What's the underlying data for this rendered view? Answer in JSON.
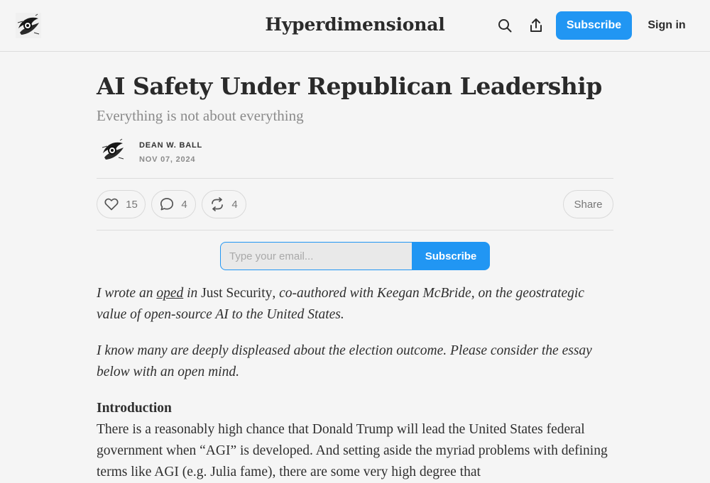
{
  "header": {
    "site_title": "Hyperdimensional",
    "subscribe_label": "Subscribe",
    "signin_label": "Sign in",
    "logo_icon": "publication-logo",
    "search_icon": "search-icon",
    "share_icon": "share-icon"
  },
  "post": {
    "title": "AI Safety Under Republican Leadership",
    "subtitle": "Everything is not about everything",
    "author": "DEAN W. BALL",
    "date": "NOV 07, 2024"
  },
  "actions": {
    "likes": "15",
    "comments": "4",
    "restacks": "4",
    "share_label": "Share"
  },
  "subscribe_form": {
    "placeholder": "Type your email...",
    "button_label": "Subscribe"
  },
  "content": {
    "p1_prefix": "I wrote an ",
    "p1_link": "oped",
    "p1_middle": " in ",
    "p1_roman": "Just Security",
    "p1_suffix": ", co-authored with Keegan McBride, on the geostrategic value of open-source AI to the United States.",
    "p2": "I know many are deeply displeased about the election outcome. Please consider the essay below with an open mind.",
    "heading": "Introduction",
    "p3": "There is a reasonably high chance that Donald Trump will lead the United States federal government when “AGI” is developed. And setting aside the myriad problems with defining terms like AGI (e.g. Julia fame), there are some very high degree that"
  },
  "colors": {
    "accent": "#2196f3",
    "background": "#f5f5f5",
    "divider": "#dcdcdc"
  }
}
